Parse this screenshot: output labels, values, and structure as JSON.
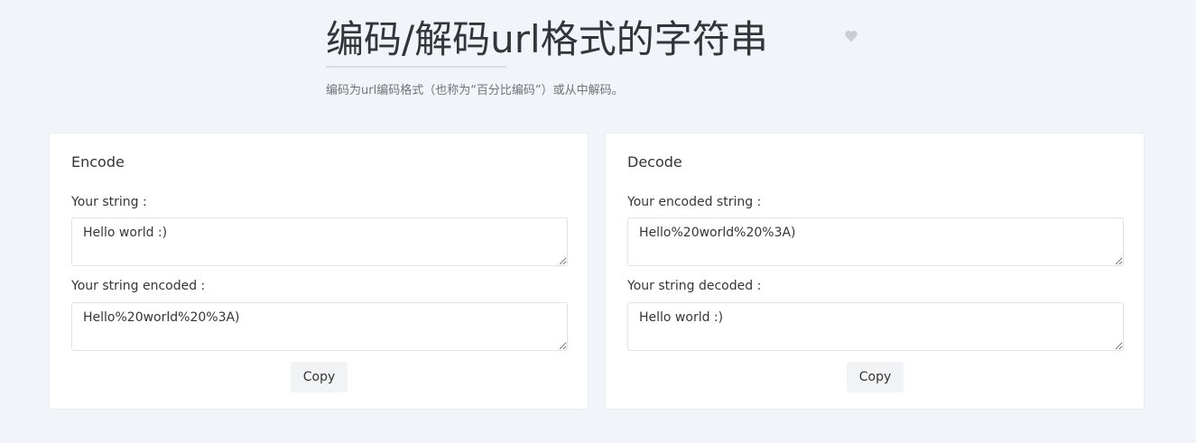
{
  "header": {
    "title": "编码/解码url格式的字符串",
    "description": "编码为url编码格式（也称为“百分比编码”）或从中解码。",
    "favorite_icon": "heart-icon"
  },
  "colors": {
    "background": "#f1f4f9",
    "card": "#ffffff",
    "heart": "#c9ced6",
    "button": "#f1f3f5"
  },
  "encode": {
    "title": "Encode",
    "input_label": "Your string :",
    "input_value": "Hello world :)",
    "output_label": "Your string encoded :",
    "output_value": "Hello%20world%20%3A)",
    "copy_label": "Copy"
  },
  "decode": {
    "title": "Decode",
    "input_label": "Your encoded string :",
    "input_value": "Hello%20world%20%3A)",
    "output_label": "Your string decoded :",
    "output_value": "Hello world :)",
    "copy_label": "Copy"
  }
}
